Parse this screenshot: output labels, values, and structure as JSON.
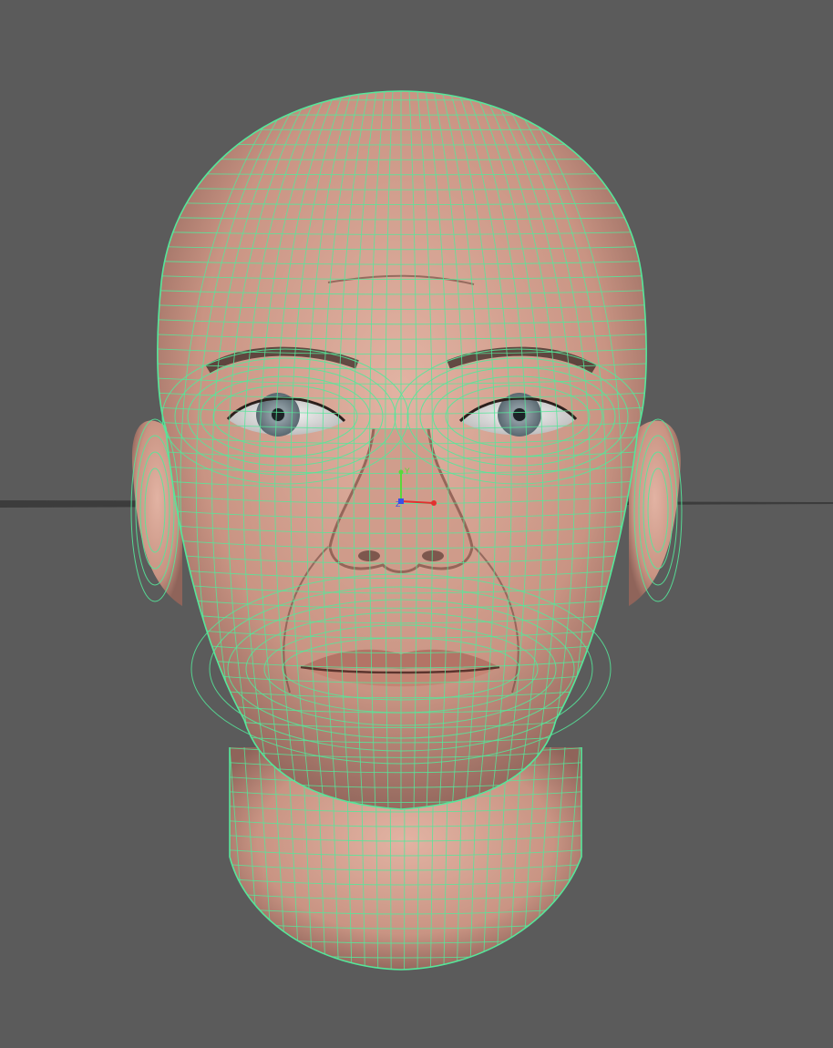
{
  "viewport": {
    "background_color": "#5b5b5b",
    "view": "front",
    "shading": "textured-with-wireframe-on-shaded"
  },
  "model": {
    "type": "human-head",
    "selected": true,
    "wireframe_color": "#55e79a",
    "skin_color": "#d8a493",
    "eye_iris_color": "#7f8d93"
  },
  "ground_grid": {
    "color": "#3c3c3c"
  },
  "manipulator": {
    "axes": [
      {
        "label": "Y",
        "color": "#5ad83a"
      },
      {
        "label": "X",
        "color": "#e23030"
      },
      {
        "label": "Z",
        "color": "#3950e8"
      }
    ]
  }
}
